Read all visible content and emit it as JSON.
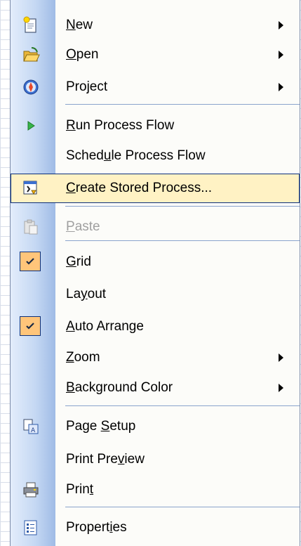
{
  "menu": {
    "items": {
      "new": {
        "label": "New",
        "mnemonic": "N",
        "rest": "ew",
        "icon": "new-document-icon",
        "submenu": true
      },
      "open": {
        "label": "Open",
        "mnemonic": "O",
        "rest": "pen",
        "icon": "open-folder-icon",
        "submenu": true
      },
      "project": {
        "label": "Project",
        "icon": "project-compass-icon",
        "submenu": true
      },
      "run_process_flow": {
        "label": "Run Process Flow",
        "mnemonic": "R",
        "rest": "un Process Flow",
        "icon": "run-play-icon"
      },
      "schedule_process_flow": {
        "label": "Schedule Process Flow",
        "pre": "Sched",
        "mnemonic": "u",
        "rest": "le Process Flow"
      },
      "create_stored_process": {
        "label": "Create Stored Process...",
        "mnemonic": "C",
        "rest": "reate Stored Process...",
        "icon": "stored-process-icon",
        "highlighted": true
      },
      "paste": {
        "label": "Paste",
        "mnemonic": "P",
        "rest": "aste",
        "icon": "paste-clipboard-icon",
        "disabled": true
      },
      "grid": {
        "label": "Grid",
        "mnemonic": "G",
        "rest": "rid",
        "checked": true
      },
      "layout": {
        "label": "Layout",
        "pre": "La",
        "mnemonic": "y",
        "rest": "out"
      },
      "auto_arrange": {
        "label": "Auto Arrange",
        "mnemonic": "A",
        "rest": "uto Arrange",
        "checked": true
      },
      "zoom": {
        "label": "Zoom",
        "mnemonic": "Z",
        "rest": "oom",
        "submenu": true
      },
      "background_color": {
        "label": "Background Color",
        "mnemonic": "B",
        "rest": "ackground Color",
        "submenu": true
      },
      "page_setup": {
        "label": "Page Setup",
        "pre": "Page ",
        "mnemonic": "S",
        "rest": "etup",
        "icon": "page-setup-icon"
      },
      "print_preview": {
        "label": "Print Preview",
        "pre": "Print Pre",
        "mnemonic": "v",
        "rest": "iew"
      },
      "print": {
        "label": "Print",
        "pre": "Prin",
        "mnemonic": "t",
        "rest": "",
        "icon": "printer-icon"
      },
      "properties": {
        "label": "Properties",
        "pre": "Propert",
        "mnemonic": "i",
        "rest": "es",
        "icon": "properties-icon"
      }
    }
  },
  "colors": {
    "highlight_fill": "#fff2c4",
    "highlight_border": "#0b2f7a",
    "check_fill": "#ffc57a",
    "disabled_text": "#a0a0a0"
  }
}
